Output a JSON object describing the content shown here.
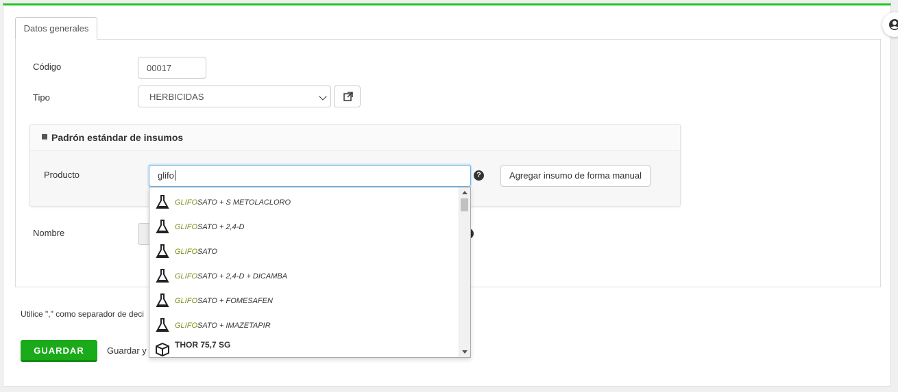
{
  "tab": {
    "label": "Datos generales"
  },
  "form": {
    "codigo_label": "Código",
    "codigo_value": "00017",
    "tipo_label": "Tipo",
    "tipo_value": "HERBICIDAS",
    "nombre_label": "Nombre"
  },
  "panel": {
    "title": "Padrón estándar de insumos",
    "producto_label": "Producto",
    "search_value": "glifo",
    "help_glyph": "?",
    "manual_button": "Agregar insumo de forma manual"
  },
  "dropdown": {
    "items": [
      {
        "match": "GLIFO",
        "rest": "SATO + S METOLACLORO",
        "icon": "flask-icon"
      },
      {
        "match": "GLIFO",
        "rest": "SATO + 2,4-D",
        "icon": "flask-icon"
      },
      {
        "match": "GLIFO",
        "rest": "SATO",
        "icon": "flask-icon"
      },
      {
        "match": "GLIFO",
        "rest": "SATO + 2,4-D + DICAMBA",
        "icon": "flask-icon"
      },
      {
        "match": "GLIFO",
        "rest": "SATO + FOMESAFEN",
        "icon": "flask-icon"
      },
      {
        "match": "GLIFO",
        "rest": "SATO + IMAZETAPIR",
        "icon": "flask-icon"
      }
    ],
    "box_item": {
      "name": "THOR 75,7 SG",
      "icon": "box-icon"
    }
  },
  "note": "Utilice \",\" como separador de deci",
  "save_button": "GUARDAR",
  "save_link": "Guardar y",
  "colors": {
    "accent": "#1fc51f",
    "save": "#1aaa1a",
    "highlight": "#7a8c14"
  }
}
